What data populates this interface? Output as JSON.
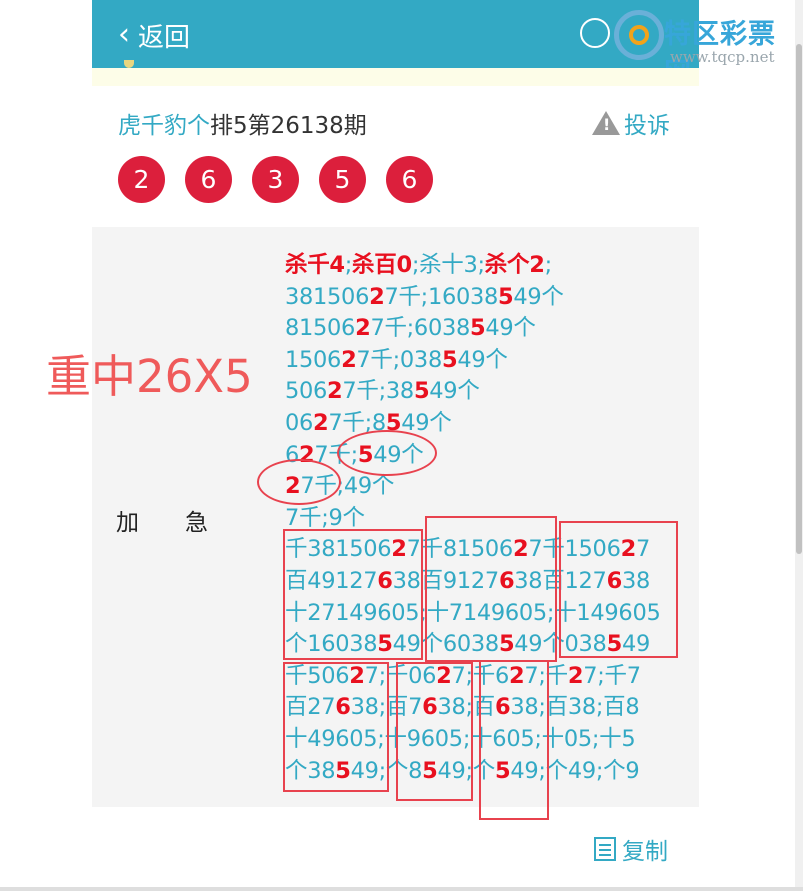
{
  "header": {
    "back_label": "返回"
  },
  "watermark": {
    "title": "特区彩票网",
    "url": "www.tqcp.net"
  },
  "post": {
    "author": "虎千豹个",
    "title": "排5第26138期",
    "complain_label": "投诉"
  },
  "balls": [
    "2",
    "6",
    "3",
    "5",
    "6"
  ],
  "content_label": {
    "left": "加",
    "right": "急"
  },
  "annotation": {
    "text": "重中26X5"
  },
  "lines": [
    [
      [
        "杀千4",
        "r"
      ],
      [
        ";",
        ""
      ],
      [
        "杀百0",
        "r"
      ],
      [
        ";杀十3;",
        ""
      ],
      [
        "杀个2",
        "r"
      ],
      [
        ";",
        ""
      ]
    ],
    [
      [
        "381506",
        ""
      ],
      [
        "2",
        "r"
      ],
      [
        "7千;16038",
        ""
      ],
      [
        "5",
        "r"
      ],
      [
        "49个",
        ""
      ]
    ],
    [
      [
        "81506",
        ""
      ],
      [
        "2",
        "r"
      ],
      [
        "7千;6038",
        ""
      ],
      [
        "5",
        "r"
      ],
      [
        "49个",
        ""
      ]
    ],
    [
      [
        "1506",
        ""
      ],
      [
        "2",
        "r"
      ],
      [
        "7千;038",
        ""
      ],
      [
        "5",
        "r"
      ],
      [
        "49个",
        ""
      ]
    ],
    [
      [
        "506",
        ""
      ],
      [
        "2",
        "r"
      ],
      [
        "7千;38",
        ""
      ],
      [
        "5",
        "r"
      ],
      [
        "49个",
        ""
      ]
    ],
    [
      [
        "06",
        ""
      ],
      [
        "2",
        "r"
      ],
      [
        "7千;8",
        ""
      ],
      [
        "5",
        "r"
      ],
      [
        "49个",
        ""
      ]
    ],
    [
      [
        "6",
        ""
      ],
      [
        "2",
        "r"
      ],
      [
        "7千;",
        ""
      ],
      [
        "5",
        "r"
      ],
      [
        "49个",
        ""
      ]
    ],
    [
      [
        "2",
        "r"
      ],
      [
        "7千;49个",
        ""
      ]
    ],
    [
      [
        "7千;9个",
        ""
      ]
    ],
    [
      [
        "千381506",
        ""
      ],
      [
        "2",
        "r"
      ],
      [
        "7千81506",
        ""
      ],
      [
        "2",
        "r"
      ],
      [
        "7千1506",
        ""
      ],
      [
        "2",
        "r"
      ],
      [
        "7",
        ""
      ]
    ],
    [
      [
        "百49127",
        ""
      ],
      [
        "6",
        "r"
      ],
      [
        "38百9127",
        ""
      ],
      [
        "6",
        "r"
      ],
      [
        "38百127",
        ""
      ],
      [
        "6",
        "r"
      ],
      [
        "38",
        ""
      ]
    ],
    [
      [
        "十27149605;十7149605;十149605",
        ""
      ]
    ],
    [
      [
        "个16038",
        ""
      ],
      [
        "5",
        "r"
      ],
      [
        "49个6038",
        ""
      ],
      [
        "5",
        "r"
      ],
      [
        "49个038",
        ""
      ],
      [
        "5",
        "r"
      ],
      [
        "49",
        ""
      ]
    ],
    [
      [
        "千506",
        ""
      ],
      [
        "2",
        "r"
      ],
      [
        "7;千06",
        ""
      ],
      [
        "2",
        "r"
      ],
      [
        "7;千6",
        ""
      ],
      [
        "2",
        "r"
      ],
      [
        "7;千",
        ""
      ],
      [
        "2",
        "r"
      ],
      [
        "7;千7",
        ""
      ]
    ],
    [
      [
        "百27",
        ""
      ],
      [
        "6",
        "r"
      ],
      [
        "38;百7",
        ""
      ],
      [
        "6",
        "r"
      ],
      [
        "38;百",
        ""
      ],
      [
        "6",
        "r"
      ],
      [
        "38;百38;百8",
        ""
      ]
    ],
    [
      [
        "十49605;十9605;十605;十05;十5",
        ""
      ]
    ],
    [
      [
        "个38",
        ""
      ],
      [
        "5",
        "r"
      ],
      [
        "49;个8",
        ""
      ],
      [
        "5",
        "r"
      ],
      [
        "49;个",
        ""
      ],
      [
        "5",
        "r"
      ],
      [
        "49;个49;个9",
        ""
      ]
    ]
  ],
  "footer": {
    "copy_label": "复制"
  },
  "colors": {
    "header_bg": "#33a9c4",
    "ball": "#dc1f3c",
    "highlight": "#e8101f",
    "annotation": "#e8424e"
  }
}
